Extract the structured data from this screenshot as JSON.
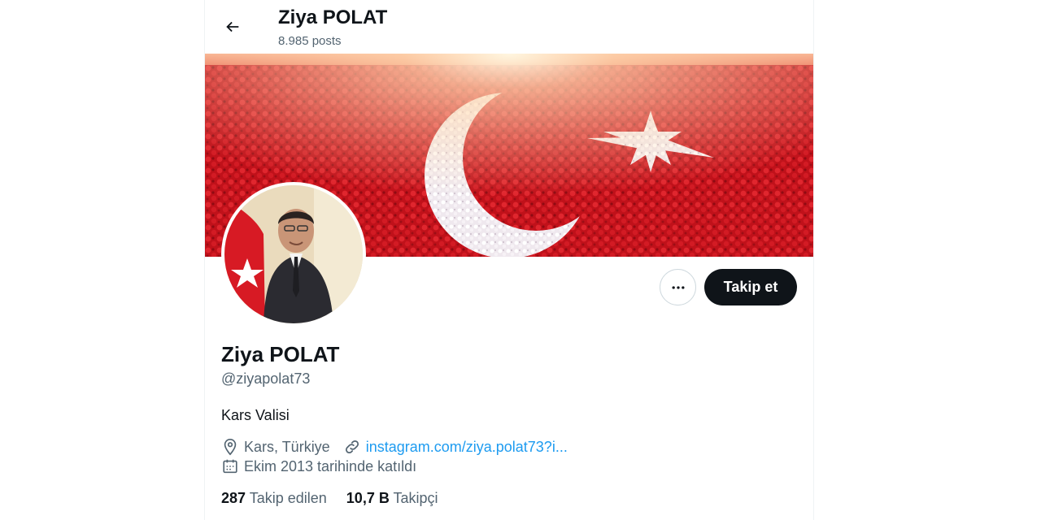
{
  "header": {
    "title": "Ziya POLAT",
    "posts_count": "8.985 posts"
  },
  "profile": {
    "display_name": "Ziya POLAT",
    "handle": "@ziyapolat73",
    "bio": "Kars Valisi",
    "location": "Kars, Türkiye",
    "website": "instagram.com/ziya.polat73?i...",
    "joined": "Ekim 2013 tarihinde katıldı"
  },
  "actions": {
    "follow_label": "Takip et"
  },
  "stats": {
    "following_count": "287",
    "following_label": "Takip edilen",
    "followers_count": "10,7 B",
    "followers_label": "Takipçi"
  },
  "colors": {
    "accent_link": "#1d9bf0",
    "follow_button_bg": "#0f1419",
    "secondary_text": "#536471"
  },
  "icons": {
    "back": "arrow-left-icon",
    "more": "more-horizontal-icon",
    "location": "location-pin-icon",
    "link": "link-icon",
    "calendar": "calendar-icon"
  }
}
